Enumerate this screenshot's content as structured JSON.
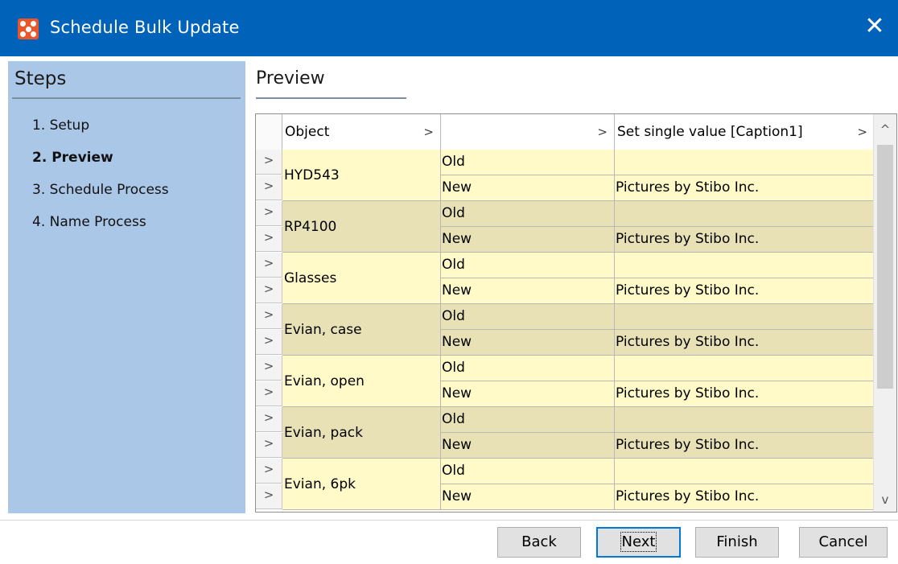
{
  "window": {
    "title": "Schedule Bulk Update",
    "close_symbol": "✕",
    "app_icon": "stibo-app-icon"
  },
  "steps": {
    "header": "Steps",
    "items": [
      {
        "label": "1. Setup",
        "active": false
      },
      {
        "label": "2. Preview",
        "active": true
      },
      {
        "label": "3. Schedule Process",
        "active": false
      },
      {
        "label": "4. Name Process",
        "active": false
      }
    ]
  },
  "preview": {
    "header": "Preview",
    "columns": [
      {
        "label": "Object"
      },
      {
        "label": ""
      },
      {
        "label": "Set single value [Caption1]"
      }
    ],
    "sort_chevron": ">",
    "row_handle": ">",
    "rows": [
      {
        "object": "HYD543",
        "old_label": "Old",
        "new_label": "New",
        "old_value": "",
        "new_value": "Pictures by Stibo Inc."
      },
      {
        "object": "RP4100",
        "old_label": "Old",
        "new_label": "New",
        "old_value": "",
        "new_value": "Pictures by Stibo Inc."
      },
      {
        "object": "Glasses",
        "old_label": "Old",
        "new_label": "New",
        "old_value": "",
        "new_value": "Pictures by Stibo Inc."
      },
      {
        "object": "Evian, case",
        "old_label": "Old",
        "new_label": "New",
        "old_value": "",
        "new_value": "Pictures by Stibo Inc."
      },
      {
        "object": "Evian, open",
        "old_label": "Old",
        "new_label": "New",
        "old_value": "",
        "new_value": "Pictures by Stibo Inc."
      },
      {
        "object": "Evian, pack",
        "old_label": "Old",
        "new_label": "New",
        "old_value": "",
        "new_value": "Pictures by Stibo Inc."
      },
      {
        "object": "Evian, 6pk",
        "old_label": "Old",
        "new_label": "New",
        "old_value": "",
        "new_value": "Pictures by Stibo Inc."
      }
    ],
    "scroll_up_symbol": "^",
    "scroll_down_symbol": "v"
  },
  "footer": {
    "back_label": "Back",
    "next_label": "Next",
    "finish_label": "Finish",
    "cancel_label": "Cancel"
  },
  "colors": {
    "titlebar": "#0162b9",
    "steps_panel": "#abc7e8",
    "row_light": "#fffac8",
    "row_dark": "#e9e1b6",
    "app_icon": "#e8562a"
  }
}
